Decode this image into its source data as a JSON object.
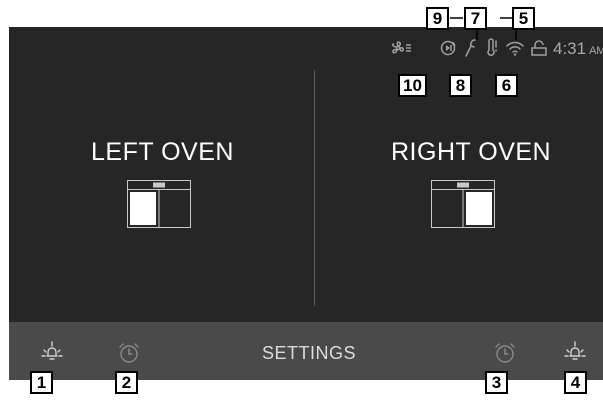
{
  "left_oven": {
    "title": "LEFT OVEN",
    "active_compartment": "left"
  },
  "right_oven": {
    "title": "RIGHT OVEN",
    "active_compartment": "right"
  },
  "status_bar": {
    "icons": [
      "fan-icon",
      "remote-enable-icon",
      "probe-icon",
      "thermometer-icon",
      "wifi-icon",
      "lock-icon"
    ],
    "time": "4:31",
    "ampm": "AM"
  },
  "bottom_bar": {
    "settings_label": "SETTINGS",
    "icons": [
      "left-light-icon",
      "left-timer-icon",
      "right-timer-icon",
      "right-light-icon"
    ]
  },
  "callouts": {
    "c1": "1",
    "c2": "2",
    "c3": "3",
    "c4": "4",
    "c5": "5",
    "c6": "6",
    "c7": "7",
    "c8": "8",
    "c9": "9",
    "c10": "10"
  },
  "colors": {
    "screen_bg": "#262626",
    "bar_bg": "#4a4a4a",
    "icon_gray": "#a0a0a0",
    "text_white": "#ffffff"
  }
}
